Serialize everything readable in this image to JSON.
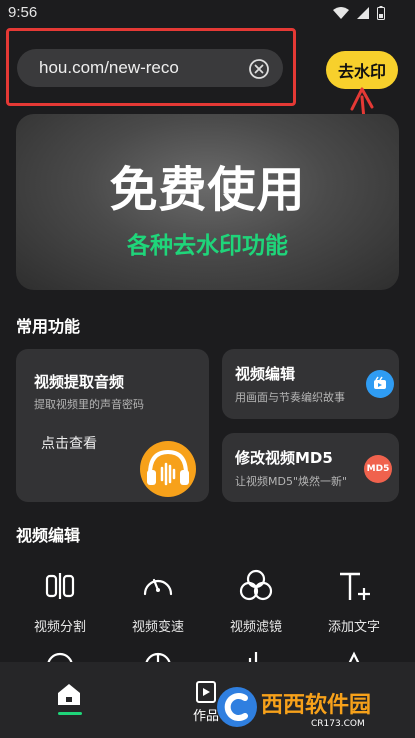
{
  "status_bar": {
    "time": "9:56"
  },
  "url_input": {
    "value": "hou.com/new-reco"
  },
  "remove_watermark_button": {
    "label": "去水印"
  },
  "banner": {
    "title": "免费使用",
    "subtitle": "各种去水印功能"
  },
  "common_functions": {
    "title": "常用功能",
    "cards": [
      {
        "title": "视频提取音频",
        "desc": "提取视频里的声音密码",
        "action": "点击查看"
      },
      {
        "title": "视频编辑",
        "desc": "用画面与节奏编织故事"
      },
      {
        "title": "修改视频MD5",
        "desc": "让视频MD5\"焕然一新\"",
        "badge": "MD5"
      }
    ]
  },
  "video_editing": {
    "title": "视频编辑",
    "tools": [
      {
        "label": "视频分割",
        "icon": "split-icon"
      },
      {
        "label": "视频变速",
        "icon": "speedometer-icon"
      },
      {
        "label": "视频滤镜",
        "icon": "filter-icon"
      },
      {
        "label": "添加文字",
        "icon": "add-text-icon"
      }
    ]
  },
  "bottom_nav": {
    "items": [
      {
        "label": "",
        "icon": "home-icon"
      },
      {
        "label": "作品",
        "icon": "works-icon"
      }
    ]
  },
  "watermark": {
    "text": "西西软件园",
    "subtext": "CR173.COM"
  },
  "colors": {
    "accent_yellow": "#f7d02c",
    "accent_green": "#1fd57a",
    "highlight_red": "#e53935",
    "audio_orange": "#f7a11a",
    "badge_blue": "#2f9cf3",
    "badge_red": "#f0624d"
  }
}
